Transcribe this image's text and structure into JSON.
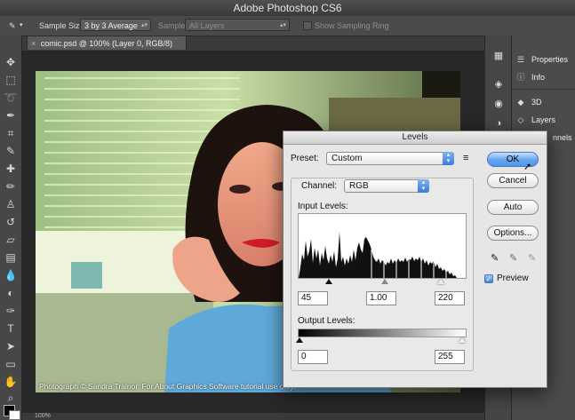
{
  "app": {
    "title": "Adobe Photoshop CS6"
  },
  "options_bar": {
    "sample_size_label": "Sample Size:",
    "sample_size_value": "3 by 3 Average",
    "sample_label": "Sample:",
    "sample_value": "All Layers",
    "show_sampling_ring_label": "Show Sampling Ring"
  },
  "document": {
    "tab_label": "comic.psd @ 100% (Layer 0, RGB/8)",
    "caption": "Photograph © Sandra Trainor. For About Graphics Software tutorial use only.",
    "zoom": "100%"
  },
  "panels": {
    "properties": "Properties",
    "info": "Info",
    "threed": "3D",
    "layers": "Layers",
    "channels": "nnels"
  },
  "levels": {
    "title": "Levels",
    "preset_label": "Preset:",
    "preset_value": "Custom",
    "channel_label": "Channel:",
    "channel_value": "RGB",
    "input_levels_label": "Input Levels:",
    "input_black": "45",
    "input_gamma": "1.00",
    "input_white": "220",
    "output_levels_label": "Output Levels:",
    "output_black": "0",
    "output_white": "255",
    "ok_label": "OK",
    "cancel_label": "Cancel",
    "auto_label": "Auto",
    "options_label": "Options...",
    "preview_label": "Preview",
    "preview_checked": true
  }
}
